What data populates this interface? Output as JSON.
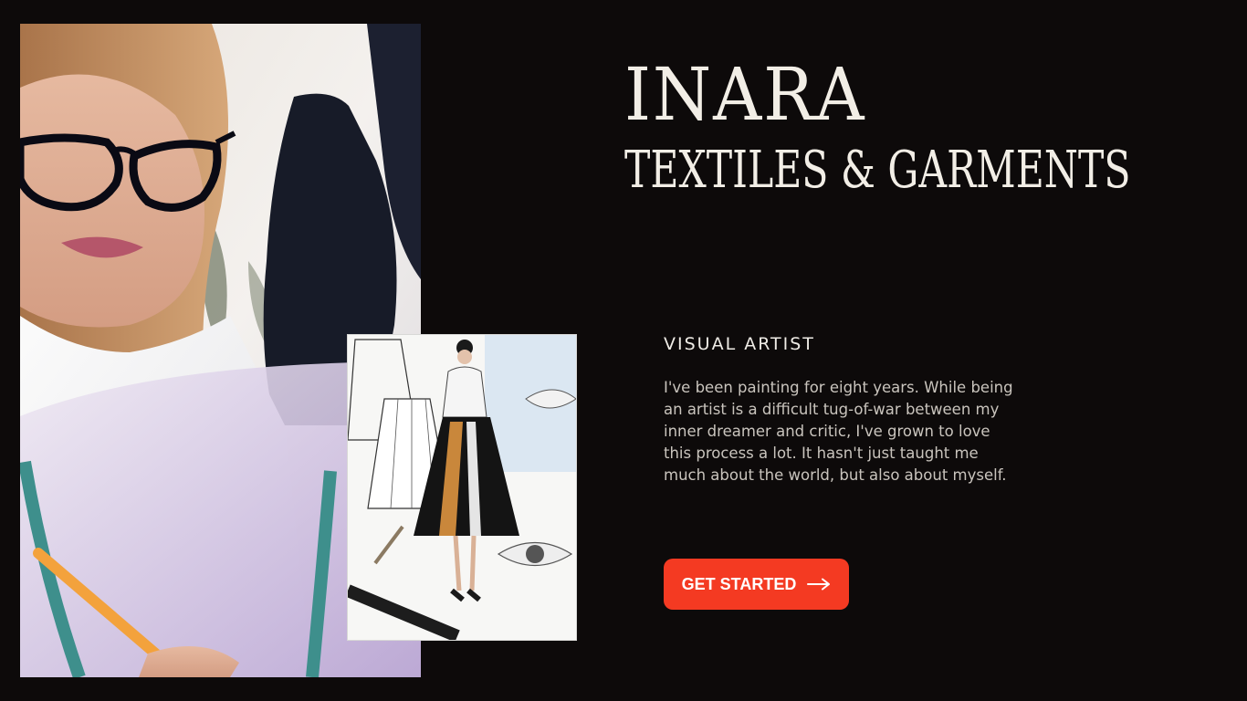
{
  "brand": {
    "title": "INARA",
    "subtitle": "TEXTILES & GARMENTS"
  },
  "artist": {
    "role": "VISUAL ARTIST",
    "bio": "I've been painting for eight years. While being an artist is a difficult tug-of-war between my inner dreamer and critic, I've grown to love this process a lot. It hasn't just taught me much about the world, but also about myself."
  },
  "cta": {
    "label": "GET STARTED",
    "icon": "arrow-right-icon"
  },
  "images": {
    "main_photo": "designer-with-glasses-photo",
    "sketch_photo": "fashion-sketch-photo"
  },
  "colors": {
    "background": "#0d0a0a",
    "accent": "#f43a22",
    "text_primary": "#f2eee6",
    "text_secondary": "#c9c4bd"
  }
}
